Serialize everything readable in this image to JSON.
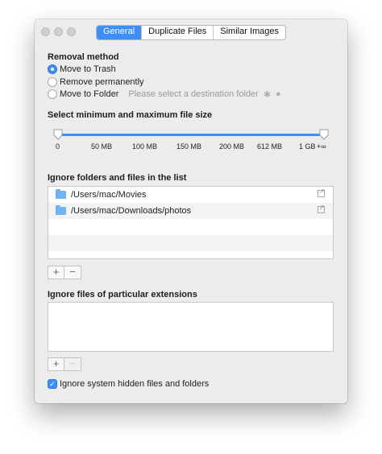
{
  "tabs": [
    "General",
    "Duplicate Files",
    "Similar Images"
  ],
  "active_tab": 0,
  "removal": {
    "title": "Removal method",
    "options": [
      "Move to Trash",
      "Remove permanently",
      "Move to Folder"
    ],
    "selected": 0,
    "folder_placeholder": "Please select a destination folder"
  },
  "file_size": {
    "title": "Select minimum and maximum file size",
    "ticks": [
      "0",
      "50 MB",
      "100 MB",
      "150 MB",
      "200 MB",
      "612 MB",
      "1 GB",
      "+∞"
    ],
    "range": [
      0,
      1
    ]
  },
  "ignore_folders": {
    "title": "Ignore folders and files in the list",
    "items": [
      "/Users/mac/Movies",
      "/Users/mac/Downloads/photos"
    ],
    "add_label": "+",
    "remove_label": "−"
  },
  "ignore_ext": {
    "title": "Ignore files of particular extensions",
    "add_label": "+",
    "remove_label": "−"
  },
  "hidden_files": {
    "label": "Ignore system hidden files and folders",
    "checked": true
  },
  "colors": {
    "accent": "#3d8ef7",
    "folder": "#6fb4ef"
  }
}
